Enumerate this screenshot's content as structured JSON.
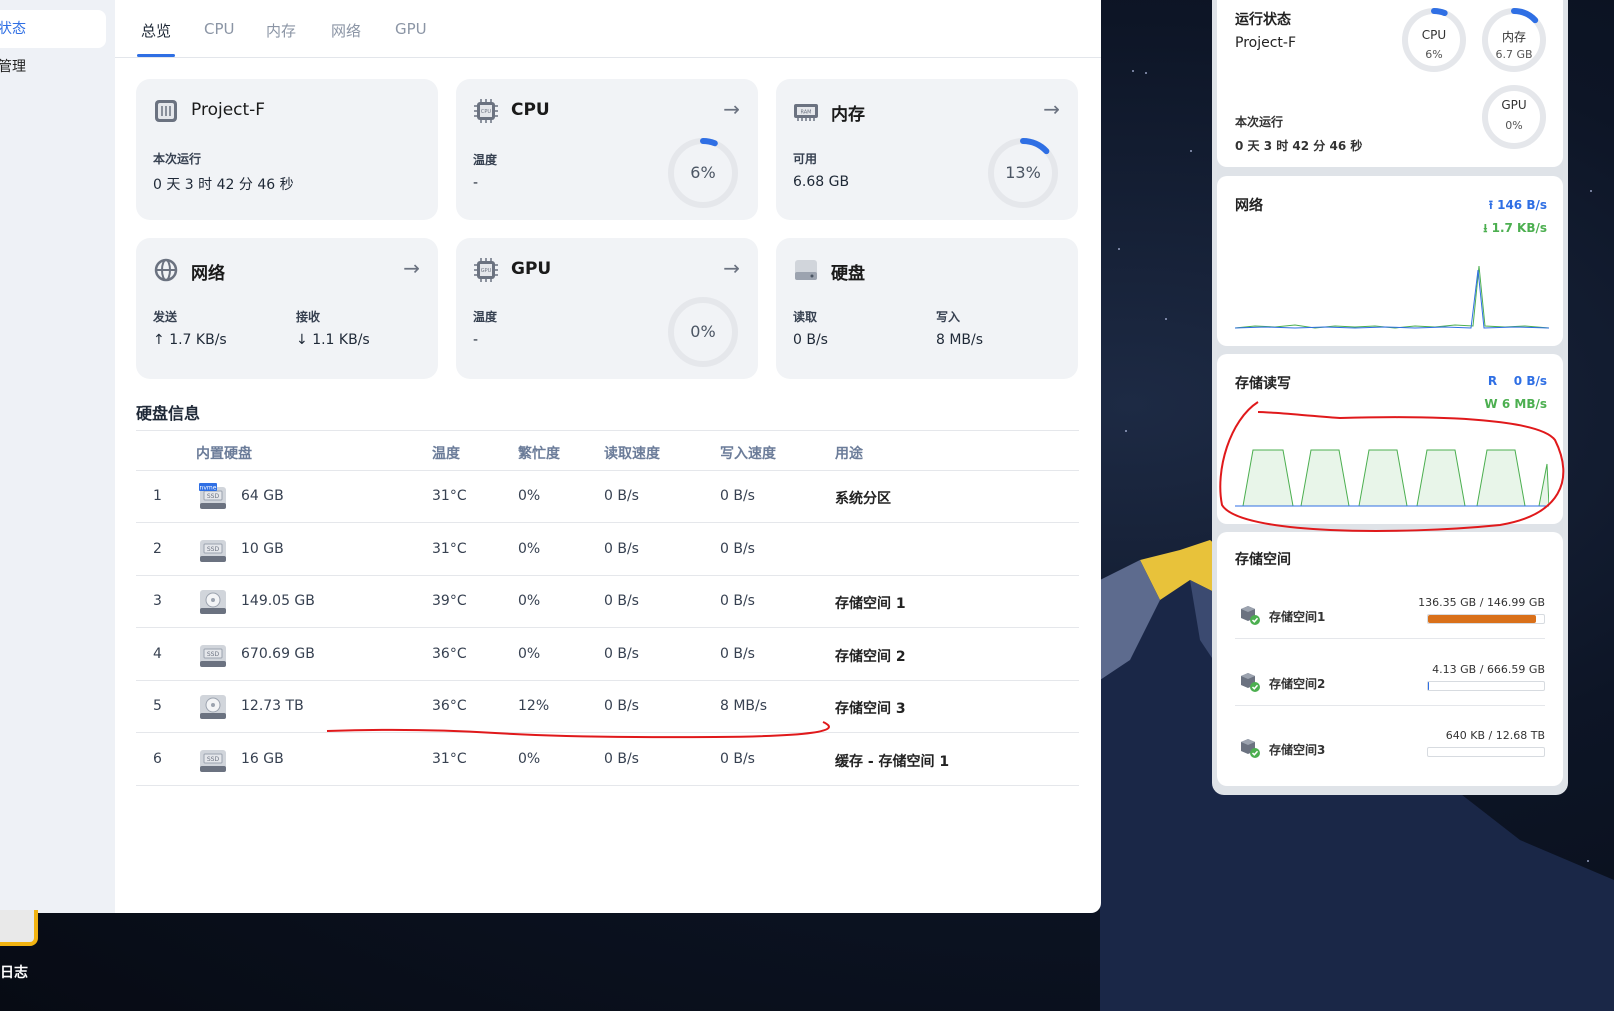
{
  "sidebar": {
    "items": [
      {
        "label": "状态"
      },
      {
        "label": "管理"
      }
    ],
    "dock_label": "日志"
  },
  "tabs": [
    "总览",
    "CPU",
    "内存",
    "网络",
    "GPU"
  ],
  "cards": {
    "host": {
      "title": "Project-F",
      "label": "本次运行",
      "value": "0 天 3 时 42 分 46 秒"
    },
    "cpu": {
      "title": "CPU",
      "label": "温度",
      "value": "-",
      "percent": "6%",
      "fraction": 0.06
    },
    "memory": {
      "title": "内存",
      "label": "可用",
      "value": "6.68 GB",
      "percent": "13%",
      "fraction": 0.13
    },
    "network": {
      "title": "网络",
      "send_label": "发送",
      "send_value": "1.7 KB/s",
      "recv_label": "接收",
      "recv_value": "1.1 KB/s"
    },
    "gpu": {
      "title": "GPU",
      "label": "温度",
      "value": "-",
      "percent": "0%",
      "fraction": 0
    },
    "disk": {
      "title": "硬盘",
      "read_label": "读取",
      "read_value": "0 B/s",
      "write_label": "写入",
      "write_value": "8 MB/s"
    }
  },
  "disk_section": {
    "title": "硬盘信息",
    "headers": [
      "内置硬盘",
      "温度",
      "繁忙度",
      "读取速度",
      "写入速度",
      "用途"
    ],
    "rows": [
      {
        "no": "1",
        "icon": "nvme-ssd-icon",
        "size": "64 GB",
        "temp": "31°C",
        "busy": "0%",
        "read": "0 B/s",
        "write": "0 B/s",
        "use": "系统分区"
      },
      {
        "no": "2",
        "icon": "ssd-icon",
        "size": "10 GB",
        "temp": "31°C",
        "busy": "0%",
        "read": "0 B/s",
        "write": "0 B/s",
        "use": ""
      },
      {
        "no": "3",
        "icon": "hdd-icon",
        "size": "149.05 GB",
        "temp": "39°C",
        "busy": "0%",
        "read": "0 B/s",
        "write": "0 B/s",
        "use": "存储空间 1"
      },
      {
        "no": "4",
        "icon": "ssd-icon",
        "size": "670.69 GB",
        "temp": "36°C",
        "busy": "0%",
        "read": "0 B/s",
        "write": "0 B/s",
        "use": "存储空间 2"
      },
      {
        "no": "5",
        "icon": "hdd-icon",
        "size": "12.73 TB",
        "temp": "36°C",
        "busy": "12%",
        "read": "0 B/s",
        "write": "8 MB/s",
        "use": "存储空间 3"
      },
      {
        "no": "6",
        "icon": "ssd-icon",
        "size": "16 GB",
        "temp": "31°C",
        "busy": "0%",
        "read": "0 B/s",
        "write": "0 B/s",
        "use": "缓存 - 存储空间 1"
      }
    ]
  },
  "widgets": {
    "status": {
      "title": "运行状态",
      "host": "Project-F",
      "uptime_label": "本次运行",
      "uptime": "0 天 3 时 42 分 46 秒",
      "cpu": {
        "label": "CPU",
        "value": "6%",
        "fraction": 0.06
      },
      "mem": {
        "label": "内存",
        "value": "6.7 GB",
        "fraction": 0.13
      },
      "gpu": {
        "label": "GPU",
        "value": "0%",
        "fraction": 0
      }
    },
    "network": {
      "title": "网络",
      "up": "146 B/s",
      "down": "1.7 KB/s"
    },
    "storage_io": {
      "title": "存储读写",
      "r_label": "R",
      "r_value": "0 B/s",
      "w_label": "W",
      "w_value": "6 MB/s"
    },
    "storage": {
      "title": "存储空间",
      "volumes": [
        {
          "name": "存储空间1",
          "used": "136.35 GB",
          "total": "146.99 GB",
          "fraction": 0.93,
          "color": "#d9701a"
        },
        {
          "name": "存储空间2",
          "used": "4.13 GB",
          "total": "666.59 GB",
          "fraction": 0.006,
          "color": "#2f6fe4"
        },
        {
          "name": "存储空间3",
          "used": "640 KB",
          "total": "12.68 TB",
          "fraction": 0,
          "color": "#2f6fe4"
        }
      ]
    }
  },
  "colors": {
    "accent": "#2f6fe4",
    "upload": "#2f6fe4",
    "download": "#4caf50",
    "annotation": "#e0191b"
  }
}
